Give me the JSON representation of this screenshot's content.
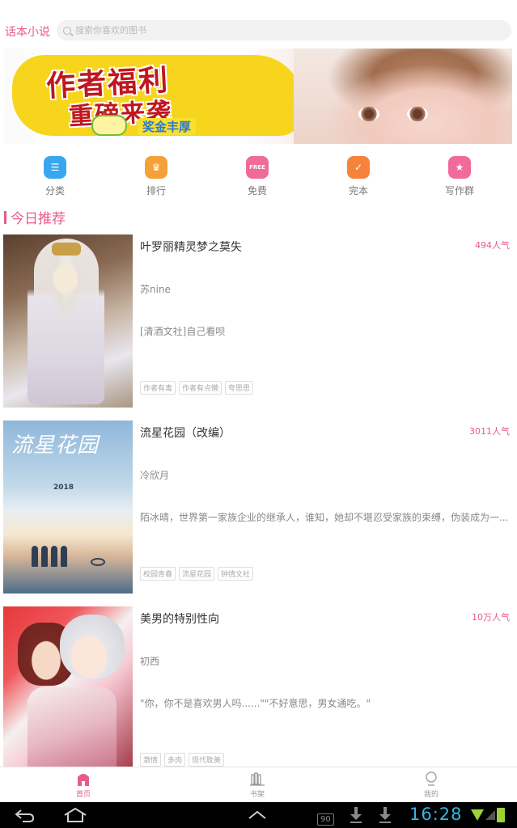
{
  "app": {
    "title": "话本小说"
  },
  "search": {
    "placeholder": "搜索你喜欢的图书"
  },
  "banner": {
    "headline_line1": "作者福利",
    "headline_line2": "重磅来袭",
    "subline": "奖金丰厚",
    "dot_count": 9,
    "active_dot": 8
  },
  "nav": {
    "items": [
      {
        "label": "分类",
        "icon": "list-icon",
        "color": "#3aa6ef"
      },
      {
        "label": "排行",
        "icon": "trophy-icon",
        "color": "#f5a13a"
      },
      {
        "label": "免费",
        "icon": "free-icon",
        "color": "#f06a9a"
      },
      {
        "label": "完本",
        "icon": "checklist-icon",
        "color": "#f5843a"
      },
      {
        "label": "写作群",
        "icon": "star-icon",
        "color": "#f06a9a"
      }
    ]
  },
  "section": {
    "title": "今日推荐"
  },
  "books": [
    {
      "title": "叶罗丽精灵梦之莫失",
      "popularity": "494人气",
      "author": "苏nine",
      "description": "[清酒文社]自己看呗",
      "tags": [
        "作者有毒",
        "作者有点懒",
        "夸思思"
      ]
    },
    {
      "title": "流星花园（改编）",
      "popularity": "3011人气",
      "author": "冷欣月",
      "description": "陌冰晴，世界第一家族企业的继承人，谁知，她却不堪忍受家族的束缚，伪装成为一...",
      "tags": [
        "校园青春",
        "流星花园",
        "钟情文社"
      ],
      "cover_title": "流星花园",
      "cover_year": "2018"
    },
    {
      "title": "美男的特别性向",
      "popularity": "10万人气",
      "author": "初西",
      "description": "\"你，你不是喜欢男人吗......\"\"不好意思，男女通吃。\"",
      "tags": [
        "激情",
        "多肉",
        "现代耽美"
      ]
    }
  ],
  "tabbar": {
    "tabs": [
      {
        "label": "首页",
        "icon": "home-icon",
        "active": true
      },
      {
        "label": "书架",
        "icon": "bookshelf-icon",
        "active": false
      },
      {
        "label": "我的",
        "icon": "profile-icon",
        "active": false
      }
    ],
    "active_color": "#e75a8c",
    "inactive_color": "#999999"
  },
  "system": {
    "time": "16:28",
    "badge": "90"
  },
  "colors": {
    "accent": "#e75a8c"
  }
}
